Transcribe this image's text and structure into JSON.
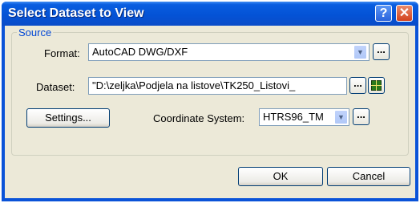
{
  "dialog": {
    "title": "Select Dataset to View",
    "help_glyph": "?",
    "close_glyph": "✕"
  },
  "source": {
    "group_label": "Source",
    "format_label": "Format:",
    "format_value": "AutoCAD DWG/DXF",
    "dataset_label": "Dataset:",
    "dataset_value": "\"D:\\zeljka\\Podjela na listove\\TK250_Listovi_",
    "ellipsis": "...",
    "settings_label": "Settings...",
    "coord_label": "Coordinate System:",
    "coord_value": "HTRS96_TM"
  },
  "buttons": {
    "ok_label": "OK",
    "cancel_label": "Cancel"
  },
  "icons": {
    "dropdown": "chevron-down-icon",
    "grid": "grid-icon"
  },
  "colors": {
    "titlebar": "#0453d6",
    "dialog_bg": "#ece9d8",
    "group_label": "#0046d5"
  }
}
